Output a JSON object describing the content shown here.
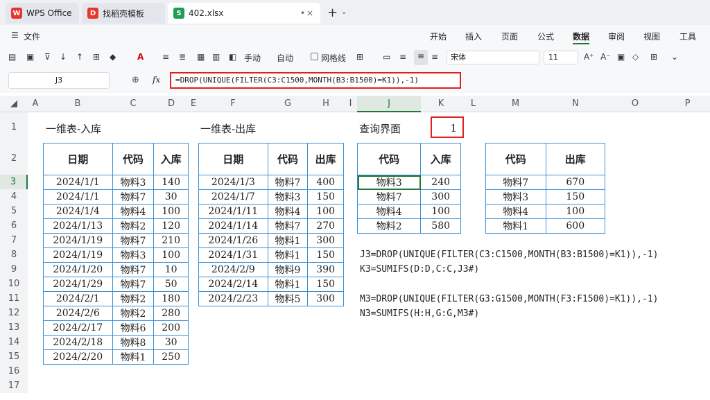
{
  "tabs": [
    {
      "label": "WPS Office"
    },
    {
      "label": "找稻壳模板"
    },
    {
      "label": "402.xlsx"
    }
  ],
  "menu": {
    "file": "文件",
    "items": [
      "开始",
      "插入",
      "页面",
      "公式",
      "数据",
      "审阅",
      "视图",
      "工具"
    ],
    "active": "数据"
  },
  "toolbar": {
    "manual": "手动",
    "auto": "自动",
    "gridlines": "网格线",
    "font": "宋体",
    "size": "11"
  },
  "formula_bar": {
    "cell_ref": "J3",
    "fx": "fx",
    "formula": "=DROP(UNIQUE(FILTER(C3:C1500,MONTH(B3:B1500)=K1)),-1)"
  },
  "columns": [
    "A",
    "B",
    "C",
    "D",
    "E",
    "F",
    "G",
    "H",
    "I",
    "J",
    "K",
    "L",
    "M",
    "N",
    "O",
    "P"
  ],
  "rows": [
    "1",
    "2",
    "3",
    "4",
    "5",
    "6",
    "7",
    "8",
    "9",
    "10",
    "11",
    "12",
    "13",
    "14",
    "15",
    "16",
    "17"
  ],
  "sheet": {
    "in_title": "一维表-入库",
    "out_title": "一维表-出库",
    "query_label": "查询界面",
    "query_value": "1",
    "in_table": {
      "headers": [
        "日期",
        "代码",
        "入库"
      ],
      "rows": [
        [
          "2024/1/1",
          "物料3",
          "140"
        ],
        [
          "2024/1/1",
          "物料7",
          "30"
        ],
        [
          "2024/1/4",
          "物料4",
          "100"
        ],
        [
          "2024/1/13",
          "物料2",
          "120"
        ],
        [
          "2024/1/19",
          "物料7",
          "210"
        ],
        [
          "2024/1/19",
          "物料3",
          "100"
        ],
        [
          "2024/1/20",
          "物料7",
          "10"
        ],
        [
          "2024/1/29",
          "物料7",
          "50"
        ],
        [
          "2024/2/1",
          "物料2",
          "180"
        ],
        [
          "2024/2/6",
          "物料2",
          "280"
        ],
        [
          "2024/2/17",
          "物料6",
          "200"
        ],
        [
          "2024/2/18",
          "物料8",
          "30"
        ],
        [
          "2024/2/20",
          "物料1",
          "250"
        ]
      ]
    },
    "out_table": {
      "headers": [
        "日期",
        "代码",
        "出库"
      ],
      "rows": [
        [
          "2024/1/3",
          "物料7",
          "400"
        ],
        [
          "2024/1/7",
          "物料3",
          "150"
        ],
        [
          "2024/1/11",
          "物料4",
          "100"
        ],
        [
          "2024/1/14",
          "物料7",
          "270"
        ],
        [
          "2024/1/26",
          "物料1",
          "300"
        ],
        [
          "2024/1/31",
          "物料1",
          "150"
        ],
        [
          "2024/2/9",
          "物料9",
          "390"
        ],
        [
          "2024/2/14",
          "物料1",
          "150"
        ],
        [
          "2024/2/23",
          "物料5",
          "300"
        ]
      ]
    },
    "query_in": {
      "headers": [
        "代码",
        "入库"
      ],
      "rows": [
        [
          "物料3",
          "240"
        ],
        [
          "物料7",
          "300"
        ],
        [
          "物料4",
          "100"
        ],
        [
          "物料2",
          "580"
        ]
      ]
    },
    "query_out": {
      "headers": [
        "代码",
        "出库"
      ],
      "rows": [
        [
          "物料7",
          "670"
        ],
        [
          "物料3",
          "150"
        ],
        [
          "物料4",
          "100"
        ],
        [
          "物料1",
          "600"
        ]
      ]
    },
    "notes": [
      "J3=DROP(UNIQUE(FILTER(C3:C1500,MONTH(B3:B1500)=K1)),-1)",
      "K3=SUMIFS(D:D,C:C,J3#)",
      "M3=DROP(UNIQUE(FILTER(G3:G1500,MONTH(F3:F1500)=K1)),-1)",
      "N3=SUMIFS(H:H,G:G,M3#)"
    ]
  },
  "colors": {
    "accent": "#1f7a3a",
    "border": "#3b8fd6",
    "highlight": "#e02020"
  }
}
